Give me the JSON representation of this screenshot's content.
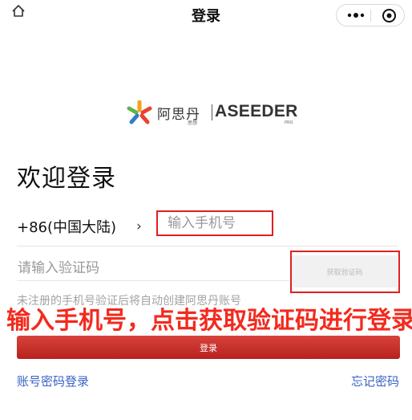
{
  "nav": {
    "title": "登录",
    "home_icon": "home-icon",
    "more_icon": "more-icon",
    "target_icon": "target-icon"
  },
  "logo": {
    "cn": "阿思丹",
    "cn_sub": "思想",
    "en": "ASEEDER",
    "en_sub": "PRO"
  },
  "welcome": "欢迎登录",
  "phone": {
    "country_code": "+86(中国大陆)",
    "chevron": "›",
    "placeholder": "输入手机号"
  },
  "code": {
    "placeholder": "请输入验证码",
    "get_code_label": "获取验证码"
  },
  "hint": "未注册的手机号验证后将自动创建阿思丹账号",
  "overlay": "输入手机号，点击获取验证码进行登录",
  "login_button": "登录",
  "links": {
    "password_login": "账号密码登录",
    "forgot_password": "忘记密码"
  },
  "colors": {
    "accent_red": "#c7302b",
    "link_blue": "#3a62c4",
    "highlight_red": "#e02020"
  }
}
